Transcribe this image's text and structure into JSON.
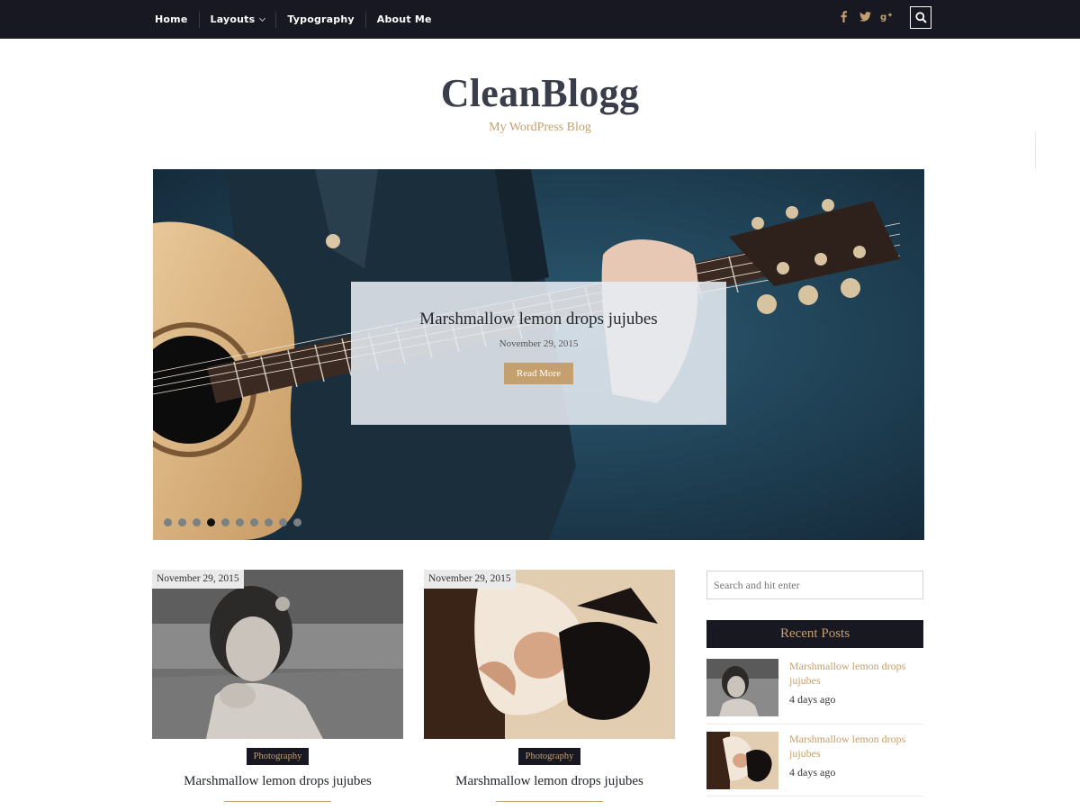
{
  "nav": {
    "items": [
      {
        "label": "Home"
      },
      {
        "label": "Layouts"
      },
      {
        "label": "Typography"
      },
      {
        "label": "About Me"
      }
    ],
    "social_icons": [
      "facebook-icon",
      "twitter-icon",
      "google-plus-icon"
    ],
    "search_icon": "search-icon"
  },
  "header": {
    "title": "CleanBlogg",
    "tagline": "My WordPress Blog"
  },
  "slider": {
    "title": "Marshmallow lemon drops jujubes",
    "date": "November 29, 2015",
    "button": "Read More",
    "dot_count": 10,
    "active_dot": 3
  },
  "posts": [
    {
      "date": "November 29, 2015",
      "category": "Photography",
      "title": "Marshmallow lemon drops jujubes"
    },
    {
      "date": "November 29, 2015",
      "category": "Photography",
      "title": "Marshmallow lemon drops jujubes"
    }
  ],
  "sidebar": {
    "search_placeholder": "Search and hit enter",
    "recent_title": "Recent Posts",
    "recent_posts": [
      {
        "title": "Marshmallow lemon drops jujubes",
        "ago": "4 days ago"
      },
      {
        "title": "Marshmallow lemon drops jujubes",
        "ago": "4 days ago"
      }
    ]
  },
  "colors": {
    "nav_bg": "#171822",
    "accent": "#c3a06d",
    "title": "#3a3d4a"
  }
}
